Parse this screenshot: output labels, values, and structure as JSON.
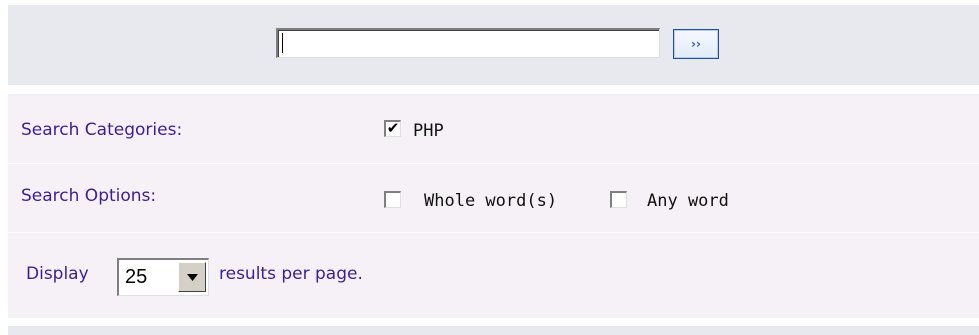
{
  "search": {
    "value": "",
    "go_label": "››"
  },
  "categories": {
    "label": "Search Categories:",
    "items": [
      {
        "label": "PHP",
        "checked": true
      }
    ]
  },
  "options": {
    "label": "Search Options:",
    "items": [
      {
        "label": "Whole word(s)",
        "checked": false
      },
      {
        "label": "Any word",
        "checked": false
      }
    ]
  },
  "display": {
    "prefix": "Display",
    "selected": "25",
    "suffix": "results per page."
  },
  "colors": {
    "band": "#e7e9ef",
    "panel": "#f6f1f6",
    "label": "#3b1f93",
    "button_border": "#1d4ea6"
  }
}
